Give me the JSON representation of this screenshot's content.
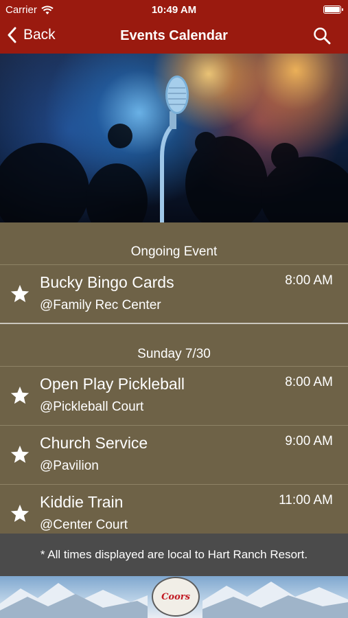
{
  "status_bar": {
    "carrier": "Carrier",
    "time": "10:49 AM"
  },
  "nav": {
    "back_label": "Back",
    "title": "Events Calendar"
  },
  "sections": [
    {
      "header": "Ongoing Event",
      "events": [
        {
          "name": "Bucky Bingo Cards",
          "location": "@Family Rec Center",
          "time": "8:00 AM"
        }
      ]
    },
    {
      "header": "Sunday 7/30",
      "events": [
        {
          "name": "Open Play Pickleball",
          "location": "@Pickleball Court",
          "time": "8:00 AM"
        },
        {
          "name": "Church Service",
          "location": "@Pavilion",
          "time": "9:00 AM"
        },
        {
          "name": "Kiddie Train",
          "location": "@Center Court",
          "time": "11:00 AM"
        }
      ]
    }
  ],
  "footer_note": "* All times displayed are local to Hart Ranch Resort.",
  "banner": {
    "logo_text": "Coors"
  },
  "colors": {
    "nav_bg": "#9a1a0f",
    "list_bg": "#6e6247",
    "footer_bg": "#4b4b4b"
  },
  "icons": {
    "back": "chevron-left-icon",
    "search": "search-icon",
    "favorite": "star-icon",
    "wifi": "wifi-icon",
    "battery": "battery-icon"
  }
}
